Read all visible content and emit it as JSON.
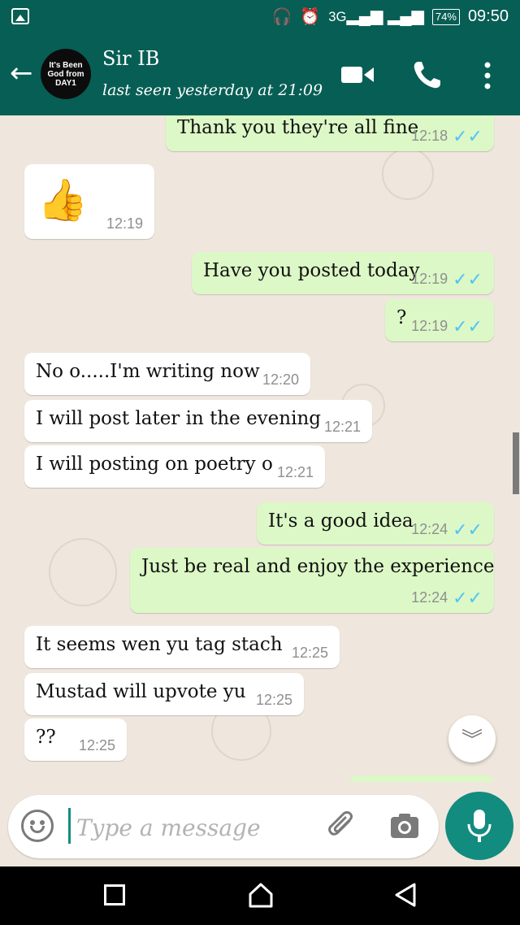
{
  "status_bar": {
    "network": "3G",
    "battery": "74%",
    "time": "09:50"
  },
  "header": {
    "avatar_text": "It's Been God from DAY1",
    "contact_name": "Sir IB",
    "last_seen": "last seen yesterday at 21:09"
  },
  "messages": [
    {
      "direction": "out",
      "text": "Thank you they're all fine",
      "time": "12:18",
      "ticks": "✓✓"
    },
    {
      "direction": "in",
      "text": "👍",
      "time": "12:19"
    },
    {
      "direction": "out",
      "text": "Have you posted today",
      "time": "12:19",
      "ticks": "✓✓"
    },
    {
      "direction": "out",
      "text": "?",
      "time": "12:19",
      "ticks": "✓✓"
    },
    {
      "direction": "in",
      "text": "No o.....I'm writing now",
      "time": "12:20"
    },
    {
      "direction": "in",
      "text": "I will post later in the evening",
      "time": "12:21"
    },
    {
      "direction": "in",
      "text": "I will posting on poetry o",
      "time": "12:21"
    },
    {
      "direction": "out",
      "text": "It's a good idea",
      "time": "12:24",
      "ticks": "✓✓"
    },
    {
      "direction": "out",
      "text": "Just be real and enjoy the experience",
      "time": "12:24",
      "ticks": "✓✓"
    },
    {
      "direction": "in",
      "text": "It seems wen yu tag stach",
      "time": "12:25"
    },
    {
      "direction": "in",
      "text": "Mustad will upvote yu",
      "time": "12:25"
    },
    {
      "direction": "in",
      "text": "??",
      "time": "12:25"
    }
  ],
  "input": {
    "placeholder": "Type a message"
  },
  "colors": {
    "header": "#075e54",
    "outgoing_bubble": "#dcf8c6",
    "incoming_bubble": "#ffffff",
    "read_tick": "#4fc3f7",
    "fab": "#128c7e"
  },
  "icons": [
    "gallery-icon",
    "headset-icon",
    "alarm-icon",
    "signal-icon",
    "back-arrow-icon",
    "video-call-icon",
    "phone-call-icon",
    "more-options-icon",
    "emoji-icon",
    "attach-icon",
    "camera-icon",
    "mic-icon",
    "scroll-down-icon"
  ]
}
